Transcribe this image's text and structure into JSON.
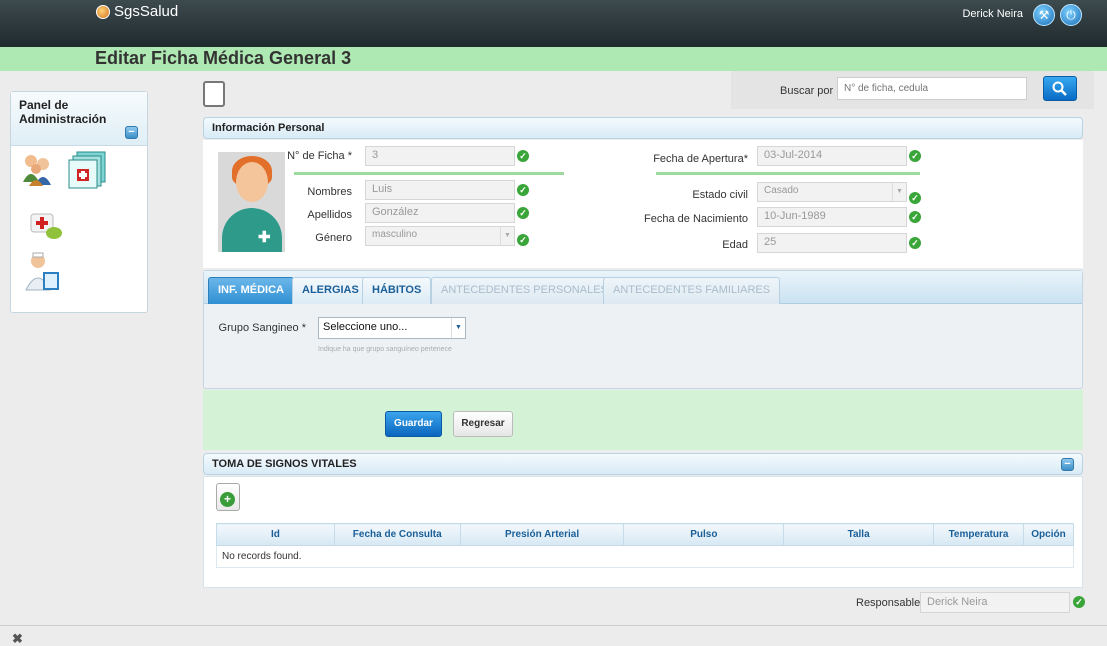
{
  "app": {
    "name": "SgsSalud",
    "user": "Derick Neira"
  },
  "page": {
    "title": "Editar Ficha Médica General 3"
  },
  "sidebar": {
    "title": "Panel de Administración",
    "icons": [
      "users-icon",
      "medical-records-icon",
      "first-aid-kit-icon",
      "doctor-icon"
    ]
  },
  "search": {
    "label": "Buscar por",
    "placeholder": "N° de ficha, cedula"
  },
  "personal": {
    "title": "Información Personal",
    "ficha_label": "N° de Ficha *",
    "ficha_value": "3",
    "nombres_label": "Nombres",
    "nombres_value": "Luis",
    "apellidos_label": "Apellidos",
    "apellidos_value": "González",
    "genero_label": "Género",
    "genero_value": "masculino",
    "apertura_label": "Fecha de Apertura*",
    "apertura_value": "03-Jul-2014",
    "estado_label": "Estado civil",
    "estado_value": "Casado",
    "nacimiento_label": "Fecha de Nacimiento",
    "nacimiento_value": "10-Jun-1989",
    "edad_label": "Edad",
    "edad_value": "25"
  },
  "tabs": [
    {
      "label": "INF. MÉDICA",
      "state": "active"
    },
    {
      "label": "ALERGIAS",
      "state": "normal"
    },
    {
      "label": "HÁBITOS",
      "state": "normal"
    },
    {
      "label": "ANTECEDENTES PERSONALES",
      "state": "disabled"
    },
    {
      "label": "ANTECEDENTES FAMILIARES",
      "state": "disabled"
    }
  ],
  "medical": {
    "grupo_label": "Grupo Sangineo *",
    "grupo_value": "Seleccione uno...",
    "grupo_hint": "Indique ha que grupo sanguíneo pertenece"
  },
  "actions": {
    "save": "Guardar",
    "back": "Regresar"
  },
  "vitals": {
    "title": "TOMA DE SIGNOS VITALES",
    "columns": [
      "Id",
      "Fecha de Consulta",
      "Presión Arterial",
      "Pulso",
      "Talla",
      "Temperatura",
      "Opción"
    ],
    "empty": "No records found."
  },
  "responsable": {
    "label": "Responsable",
    "value": "Derick Neira"
  },
  "colors": {
    "topbar": "#2b3639",
    "title_bg": "#aee8b2",
    "accent": "#2f8fd2",
    "ok": "#3aa63a"
  }
}
